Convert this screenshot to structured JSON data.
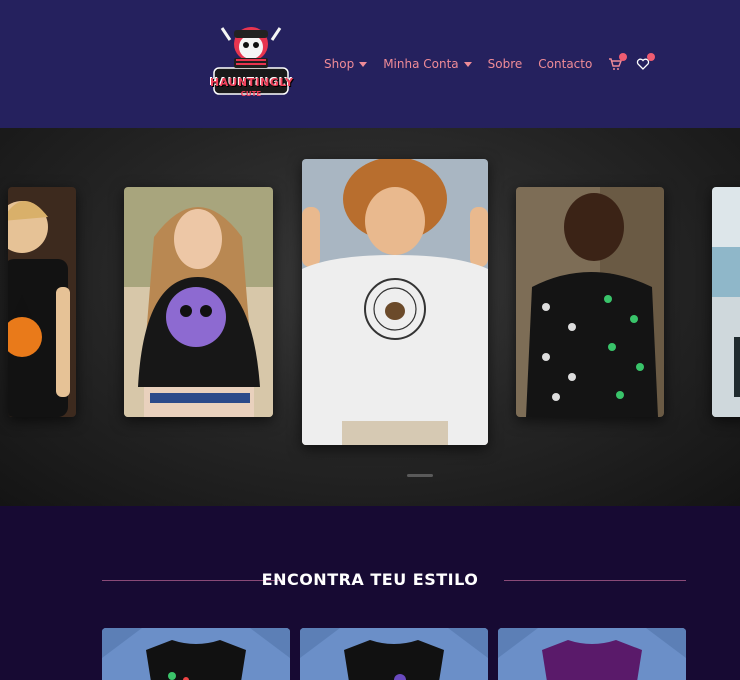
{
  "header": {
    "logo": {
      "line1": "HAUNTINGLY",
      "line2": "CUTE"
    },
    "nav": [
      {
        "label": "Shop",
        "dropdown": true
      },
      {
        "label": "Minha Conta",
        "dropdown": true
      },
      {
        "label": "Sobre",
        "dropdown": false
      },
      {
        "label": "Contacto",
        "dropdown": false
      }
    ],
    "icons": [
      "cart-icon",
      "heart-icon"
    ],
    "badge_color": "#ef5c72"
  },
  "hero": {
    "carousel_items": [
      "child-pumpkin-tee",
      "girl-purple-print-tee",
      "boy-rune-circle-sweatshirt",
      "boy-skull-print-tee",
      "beach-partial"
    ]
  },
  "style_section": {
    "title": "ENCONTRA TEU ESTILO",
    "tiles": [
      {
        "shirt_color": "#111111"
      },
      {
        "shirt_color": "#111111"
      },
      {
        "shirt_color": "#5a1a6a"
      }
    ]
  },
  "colors": {
    "header_bg": "#25215e",
    "nav_text": "#ef8b97",
    "page_bg": "#170a33",
    "accent_line": "#8a4a78"
  }
}
